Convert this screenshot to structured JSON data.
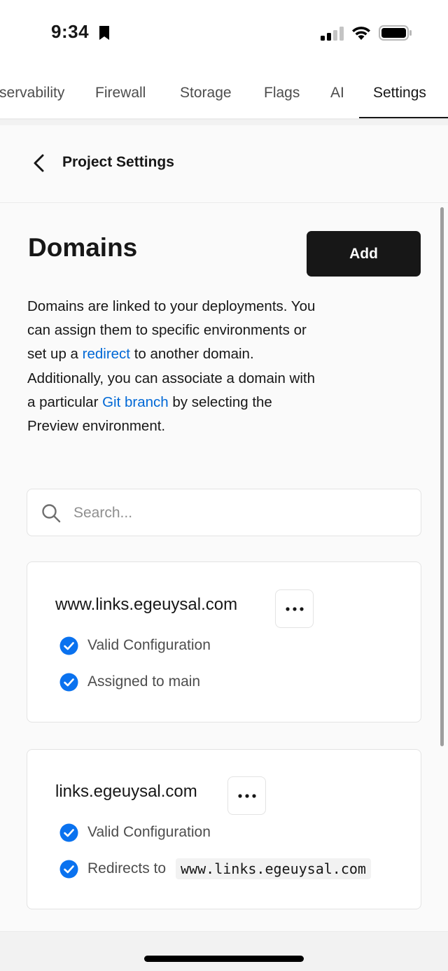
{
  "status_bar": {
    "time": "9:34"
  },
  "tabs": [
    {
      "label": "Observability"
    },
    {
      "label": "Firewall"
    },
    {
      "label": "Storage"
    },
    {
      "label": "Flags"
    },
    {
      "label": "AI"
    },
    {
      "label": "Settings",
      "active": true
    }
  ],
  "header": {
    "title": "Project Settings"
  },
  "domains_section": {
    "title": "Domains",
    "add_label": "Add",
    "description_part1": "Domains are linked to your deployments. You can assign them to specific environments or set up a ",
    "redirect_link": "redirect",
    "description_part2": " to another domain. Additionally, you can associate a domain with a particular ",
    "git_branch_link": "Git branch",
    "description_part3": " by selecting the Preview environment."
  },
  "search": {
    "placeholder": "Search..."
  },
  "domains": [
    {
      "name": "www.links.egeuysal.com",
      "status_1": "Valid Configuration",
      "status_2": "Assigned to main"
    },
    {
      "name": "links.egeuysal.com",
      "status_1": "Valid Configuration",
      "status_2": "Redirects to",
      "redirect_target": "www.links.egeuysal.com"
    }
  ],
  "colors": {
    "accent_blue": "#0068d6",
    "check_blue": "#0a72ef",
    "button_dark": "#171717"
  },
  "icons": [
    "bookmark-icon",
    "signal-icon",
    "wifi-icon",
    "battery-icon",
    "back-chevron-icon",
    "search-icon",
    "more-icon",
    "check-circle-icon"
  ]
}
